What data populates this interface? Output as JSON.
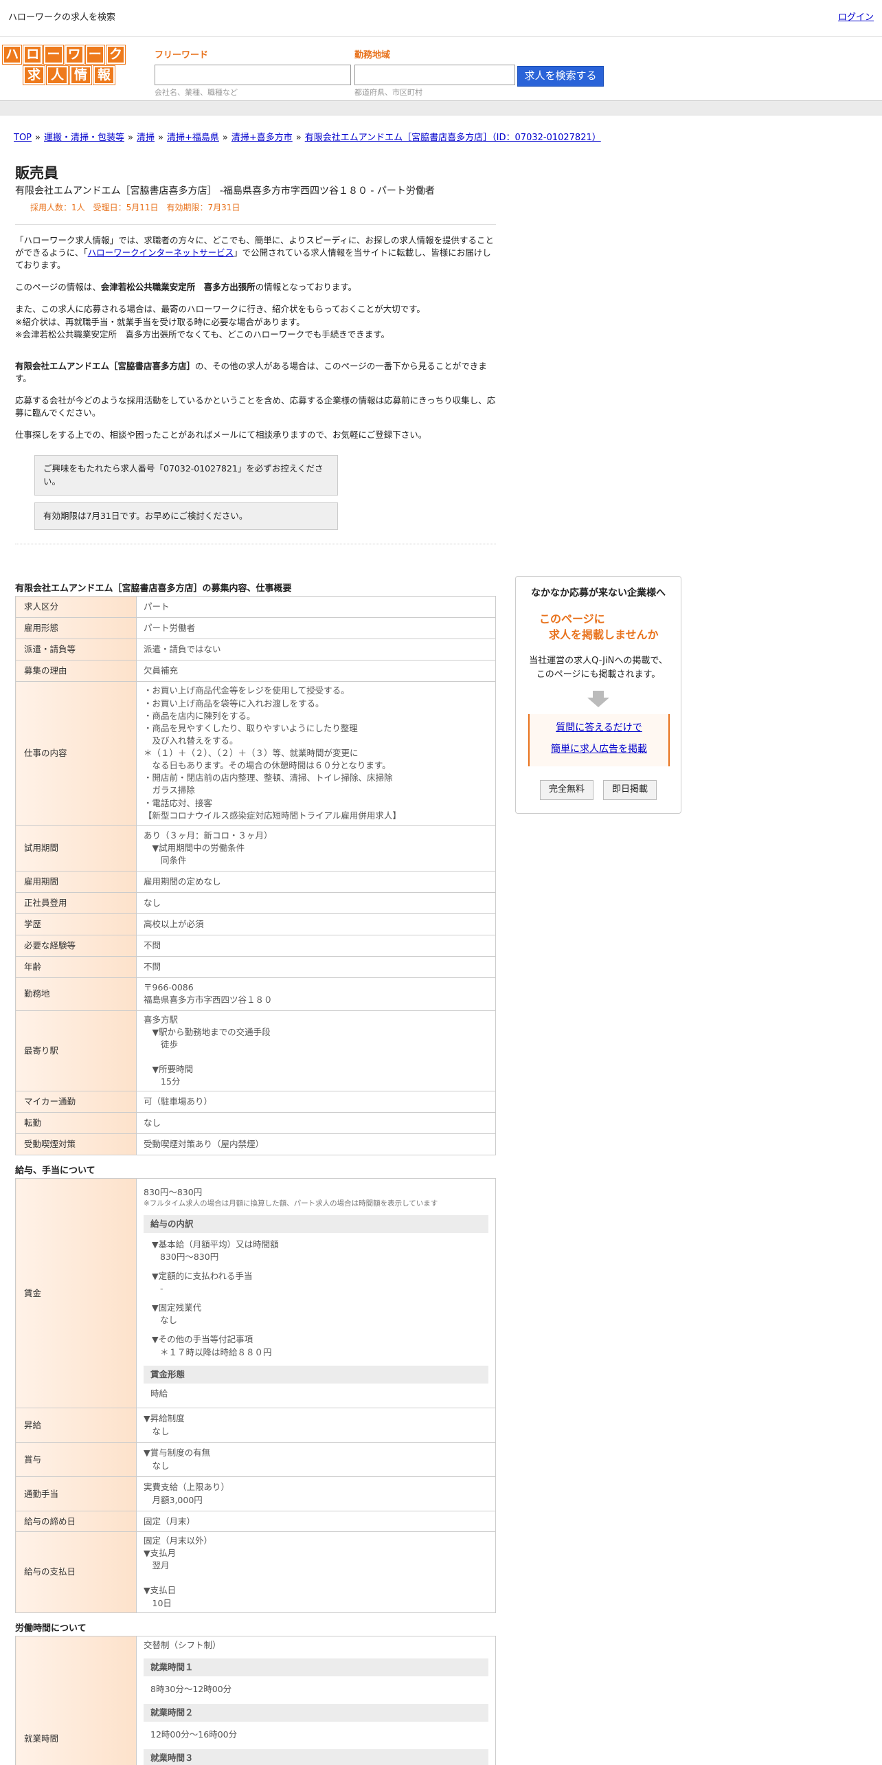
{
  "topbar": {
    "title": "ハローワークの求人を検索",
    "login": "ログイン"
  },
  "logo": {
    "row1": [
      "ハ",
      "ロ",
      "ー",
      "ワ",
      "ー",
      "ク"
    ],
    "row2": [
      "求",
      "人",
      "情",
      "報"
    ]
  },
  "search": {
    "freeword_label": "フリーワード",
    "freeword_placeholder": "会社名、業種、職種など",
    "area_label": "勤務地域",
    "area_placeholder": "都道府県、市区町村",
    "button": "求人を検索する"
  },
  "breadcrumb": {
    "items": [
      "TOP",
      "運搬・清掃・包装等",
      "清掃",
      "清掃+福島県",
      "清掃+喜多方市",
      "有限会社エムアンドエム［宮脇書店喜多方店］（ID：07032-01027821）"
    ],
    "sep": "»"
  },
  "job": {
    "title": "販売員",
    "subtitle": "有限会社エムアンドエム［宮脇書店喜多方店］ -福島県喜多方市字西四ツ谷１８０ - パート労働者",
    "meta": "採用人数：1人　受理日：5月11日　有効期限：7月31日"
  },
  "intro": {
    "p1_a": "「ハローワーク求人情報」では、求職者の方々に、どこでも、簡単に、よりスピーディに、お探しの求人情報を提供することができるように、「",
    "p1_link": "ハローワークインターネットサービス",
    "p1_b": "」で公開されている求人情報を当サイトに転載し、皆様にお届けしております。",
    "p2_a": "このページの情報は、",
    "p2_b": "会津若松公共職業安定所　喜多方出張所",
    "p2_c": "の情報となっております。",
    "p3": "また、この求人に応募される場合は、最寄のハローワークに行き、紹介状をもらっておくことが大切です。",
    "p3b": "※紹介状は、再就職手当・就業手当を受け取る時に必要な場合があります。",
    "p3c": "※会津若松公共職業安定所　喜多方出張所でなくても、どこのハローワークでも手続きできます。",
    "p4_a": "有限会社エムアンドエム［宮脇書店喜多方店］",
    "p4_b": "の、その他の求人がある場合は、このページの一番下から見ることができます。",
    "p5": "応募する会社が今どのような採用活動をしているかということを含め、応募する企業様の情報は応募前にきっちり収集し、応募に臨んでください。",
    "p6": "仕事探しをする上での、相談や困ったことがあればメールにて相談承りますので、お気軽にご登録下さい。",
    "note1": "ご興味をもたれたら求人番号「07032-01027821」を必ずお控えください。",
    "note2": "有効期限は7月31日です。お早めにご検討ください。"
  },
  "overview": {
    "title": "有限会社エムアンドエム［宮脇書店喜多方店］の募集内容、仕事概要",
    "rows": [
      {
        "k": "求人区分",
        "v": "パート"
      },
      {
        "k": "雇用形態",
        "v": "パート労働者"
      },
      {
        "k": "派遣・請負等",
        "v": "派遣・請負ではない"
      },
      {
        "k": "募集の理由",
        "v": "欠員補充"
      }
    ],
    "work_k": "仕事の内容",
    "work_lines": [
      "・お買い上げ商品代金等をレジを使用して授受する。",
      "・お買い上げ商品を袋等に入れお渡しをする。",
      "・商品を店内に陳列をする。",
      "・商品を見やすくしたり、取りやすいようにしたり整理",
      "　及び入れ替えをする。",
      "＊（１）＋（２）、（２）＋（３）等、就業時間が変更に",
      "　なる日もあります。その場合の休憩時間は６０分となります。",
      "・開店前・閉店前の店内整理、整頓、清掃、トイレ掃除、床掃除",
      "　ガラス掃除",
      "・電話応対、接客",
      "【新型コロナウイルス感染症対応短時間トライアル雇用併用求人】"
    ],
    "trial_k": "試用期間",
    "trial_lines": [
      "あり（３ヶ月：新コロ・３ヶ月）",
      "　▼試用期間中の労働条件",
      "　　同条件"
    ],
    "rows2": [
      {
        "k": "雇用期間",
        "v": "雇用期間の定めなし"
      },
      {
        "k": "正社員登用",
        "v": "なし"
      },
      {
        "k": "学歴",
        "v": "高校以上が必須"
      },
      {
        "k": "必要な経験等",
        "v": "不問"
      },
      {
        "k": "年齢",
        "v": "不問"
      }
    ],
    "loc_k": "勤務地",
    "loc_lines": [
      "〒966-0086",
      "福島県喜多方市字西四ツ谷１８０"
    ],
    "station_k": "最寄り駅",
    "station_lines": [
      "喜多方駅",
      "　▼駅から勤務地までの交通手段",
      "　　徒歩",
      "",
      "　▼所要時間",
      "　　15分"
    ],
    "rows3": [
      {
        "k": "マイカー通勤",
        "v": "可（駐車場あり）"
      },
      {
        "k": "転勤",
        "v": "なし"
      },
      {
        "k": "受動喫煙対策",
        "v": "受動喫煙対策あり（屋内禁煙）"
      }
    ]
  },
  "salary": {
    "title": "給与、手当について",
    "wage_k": "賃金",
    "wage_v": "830円〜830円",
    "wage_note": "※フルタイム求人の場合は月額に換算した額、パート求人の場合は時間額を表示しています",
    "breakdown_h": "給与の内訳",
    "base_l": "▼基本給（月額平均）又は時間額",
    "base_v": "830円〜830円",
    "fixed_l": "▼定額的に支払われる手当",
    "fixed_v": "-",
    "ot_l": "▼固定残業代",
    "ot_v": "なし",
    "other_l": "▼その他の手当等付記事項",
    "other_v": "＊１７時以降は時給８８０円",
    "form_h": "賃金形態",
    "form_v": "時給",
    "raise_k": "昇給",
    "raise_lines": [
      "▼昇給制度",
      "　なし"
    ],
    "bonus_k": "賞与",
    "bonus_lines": [
      "▼賞与制度の有無",
      "　なし"
    ],
    "commute_k": "通勤手当",
    "commute_lines": [
      "実費支給（上限あり）",
      "　月額3,000円"
    ],
    "close_k": "給与の締め日",
    "close_v": "固定（月末）",
    "pay_k": "給与の支払日",
    "pay_lines": [
      "固定（月末以外）",
      "▼支払月",
      "　翌月",
      "",
      "▼支払日",
      "　10日"
    ]
  },
  "hours": {
    "title": "労働時間について",
    "k": "就業時間",
    "type": "交替制（シフト制）",
    "t1_h": "就業時間１",
    "t1_v": "8時30分〜12時00分",
    "t2_h": "就業時間２",
    "t2_v": "12時00分〜16時00分",
    "t3_h": "就業時間３"
  },
  "side": {
    "heading": "なかなか応募が来ない企業様へ",
    "offer1": "このページに",
    "offer2": "求人を掲載しませんか",
    "desc1": "当社運営の求人Q-JiNへの掲載で、",
    "desc2": "このページにも掲載されます。",
    "link1": "質問に答えるだけで",
    "link2": "簡単に求人広告を掲載",
    "badge1": "完全無料",
    "badge2": "即日掲載"
  }
}
